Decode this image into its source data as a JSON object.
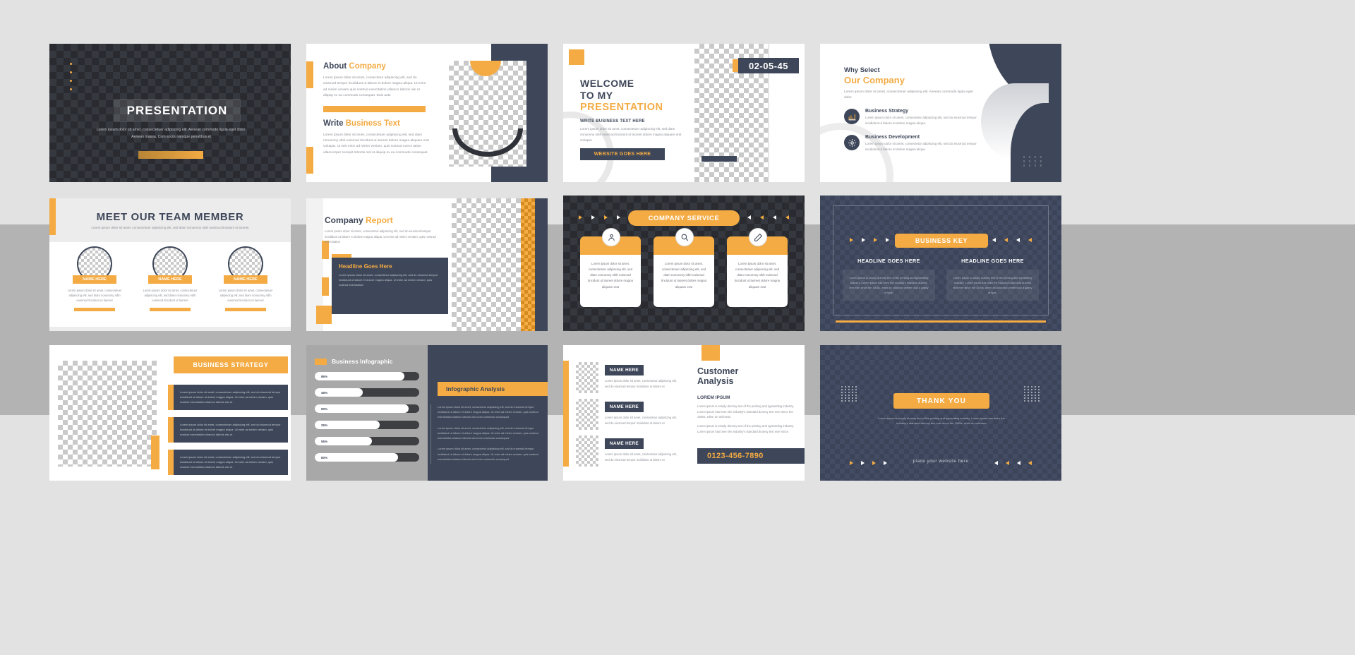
{
  "colors": {
    "navy": "#3e4759",
    "orange": "#f4ab43",
    "dark": "#292b30",
    "bg": "#e2e2e2"
  },
  "lorem": {
    "short": "Lorem ipsum dolor sit amet, consectetuer adipiscing elit, sed diam nonummy nibh euismod tincidunt ut laoreet",
    "hero": "Lorem ipsum dolor sit amet, consectetuer adipiscing elit. Aenean commodo ligula eget dolor. Aenean massa. Cum sociis natoque penatibus et",
    "p1": "Lorem ipsum dolor sit amet, consectetur adipiscing elit, sed do eiusmod tempor incididunt ut labore et dolore magna aliqua. Ut enim ad minim veniam quis nostrud exercitation ullamco laboris nisi ut aliquip ex ea commodo consequat. Duis aute",
    "p2": "Lorem ipsum dolor sit amet, consectetuer adipiscing elit, sed diam nonummy nibh euismod tincidunt ut laoreet dolore magna aliquam erat volutpat. Ut wisi enim ad minim veniam, quis nostrud exerci tation ullamcorper suscipit lobortis nisl ut aliquip ex ea commodo consequat.",
    "p3": "Lorem ipsum dolor sit amet, consectetuer adipiscing elit, sed diam nonummy nibh euismod tincidunt ut laoreet dolore magna aliquam erat volutpat.",
    "p4": "Lorem ipsum dolor sit amet, consectetuer adipiscing elit. Aenean commodo ligula eget dolor.",
    "p5": "Lorem ipsum dolor sit amet, consectetur adipiscing elit, sed do eiusmod tempor incididunt ut labore et dolore magna aliqua.",
    "p6": "Lorem ipsum dolor sit amet, consectetur adipiscing elit, sed do eiusmod tempor incididunt ut labore et dolore magna aliqua. Ut enim ad minim veniam, quis nostrud exercitation",
    "p7": "Lorem ipsum dolor sit amet, consectetuer adipiscing elit, sed do eiusmod tempor incididunt ut labore et dolore magna aliqua. Ut enim ad minim veniam, quis nostrud exercitation",
    "p8": "Lorem ipsum dolor sit amet, consectetuer adipiscing elit, sed do eiusmod tempor incididunt ut labore et dolore magna aliqua. Ut enim ad minim veniam, quis nostrud exercitation ullamco laboris nisi ut ea commodo consequat.",
    "p9": "Lorem ipsum dolor sit amet, consectetur adipiscing elit, sed do eiusmod tempor incididunt ut labore et",
    "p10": "Lorem ipsum dolor sit amet, consectetur adipiscing elit, sed do eiusmod tempor incididunt ut labore et",
    "p11": "Lorem ipsum is simply dummy text of the printing and typesetting industry. Lorem ipsum has been the industry's standard dummy text ever since.",
    "p12": "Lorem ipsum is simply dummy text of the printing and typesetting industry. Lorem ipsum has been the industry's standard dummy text ever since the 1500s, when an unknown printer took a galley of type.",
    "p13": "Lorem ipsum is simply dummy text of the printing and typesetting industry. Lorem ipsum has been the industry's standard dummy text ever since the 1500s, when an unknown",
    "svc": "Lorem ipsum dolor sit amet, consectetuer adipiscing elit, sed diam nonummy nibh euismod tincidunt ut laoreet dolore magna aliquam erat"
  },
  "slide1": {
    "title": "PRESENTATION",
    "subtitle": "Lorem ipsum dolor sit amet, consectetuer adipiscing elit. Aenean commodo ligula eget dolor. Aenean massa. Cum sociis natoque penatibus et"
  },
  "slide2": {
    "heading_dark": "About",
    "heading_accent": "Company",
    "body1": "Lorem ipsum dolor sit amet, consectetur adipiscing elit, sed do eiusmod tempor incididunt ut labore et dolore magna aliqua. Ut enim ad minim veniam quis nostrud exercitation ullamco laboris nisi ut aliquip ex ea commodo consequat. Duis aute",
    "heading2_dark": "Write",
    "heading2_accent": "Business Text",
    "body2": "Lorem ipsum dolor sit amet, consectetuer adipiscing elit, sed diam nonummy nibh euismod tincidunt ut laoreet dolore magna aliquam erat volutpat. Ut wisi enim ad minim veniam, quis nostrud exerci tation ullamcorper suscipit lobortis nisl ut aliquip ex ea commodo consequat."
  },
  "slide3": {
    "line1": "WELCOME",
    "line2": "TO MY",
    "line3": "PRESENTATION",
    "subhead": "WRITE BUSINESS TEXT HERE",
    "body": "Lorem ipsum dolor sit amet, consectetuer adipiscing elit, sed diam nonummy nibh euismod tincidunt ut laoreet dolore magna aliquam erat volutpat.",
    "button": "WEBSITE GOES HERE",
    "date": "02-05-45"
  },
  "slide4": {
    "heading_dark": "Why Select",
    "heading_accent": "Our Company",
    "intro": "Lorem ipsum dolor sit amet, consectetuer adipiscing elit. Aenean commodo ligula eget dolor.",
    "features": [
      {
        "icon": "chart-bar-icon",
        "title": "Business Strategy",
        "text": "Lorem ipsum dolor sit amet, consectetur adipiscing elit, sed do eiusmod tempor incididunt ut labore et dolore magna aliqua."
      },
      {
        "icon": "gear-icon",
        "title": "Business Development",
        "text": "Lorem ipsum dolor sit amet, consectetur adipiscing elit, sed do eiusmod tempor incididunt ut labore et dolore magna aliqua."
      }
    ],
    "decor_text": "x x x x\nx x x x\nx x x x"
  },
  "slide5": {
    "title": "MEET OUR TEAM MEMBER",
    "subtitle": "Lorem ipsum dolor sit amet, consectetuer adipiscing elit, sed diam nonummy nibh euismod tincidunt ut laoreet",
    "members": [
      {
        "name": "NAME HERE",
        "text": "Lorem ipsum dolor sit amet, consectetuer adipiscing elit, sed diam nonummy nibh euismod tincidunt ut laoreet"
      },
      {
        "name": "NAME HERE",
        "text": "Lorem ipsum dolor sit amet, consectetuer adipiscing elit, sed diam nonummy nibh euismod tincidunt ut laoreet"
      },
      {
        "name": "NAME HERE",
        "text": "Lorem ipsum dolor sit amet, consectetuer adipiscing elit, sed diam nonummy nibh euismod tincidunt ut laoreet"
      }
    ]
  },
  "slide6": {
    "heading_dark": "Company",
    "heading_accent": "Report",
    "intro": "Lorem ipsum dolor sit amet, consectetur adipiscing elit, sed do eiusmod tempor incididunt ut labore et dolore magna aliqua. Ut enim ad minim veniam, quis nostrud exercitation",
    "card_title": "Headline Goes Here",
    "card_text": "Lorem ipsum dolor sit amet, consectetur adipiscing elit, sed do eiusmod tempor incididunt ut labore et dolore magna aliqua. Ut enim ad minim veniam, quis nostrud exercitation"
  },
  "slide7": {
    "title": "COMPANY SERVICE",
    "cards": [
      {
        "icon": "user-icon",
        "text": "Lorem ipsum dolor sit amet, consectetuer adipiscing elit, sed diam nonummy nibh euismod tincidunt ut laoreet dolore magna aliquam erat"
      },
      {
        "icon": "magnifier-icon",
        "text": "Lorem ipsum dolor sit amet, consectetuer adipiscing elit, sed diam nonummy nibh euismod tincidunt ut laoreet dolore magna aliquam erat"
      },
      {
        "icon": "pencil-icon",
        "text": "Lorem ipsum dolor sit amet, consectetuer adipiscing elit, sed diam nonummy nibh euismod tincidunt ut laoreet dolore magna aliquam erat"
      }
    ]
  },
  "slide8": {
    "title": "BUSINESS KEY",
    "columns": [
      {
        "heading": "HEADLINE GOES HERE",
        "text": "Lorem ipsum is simply dummy text of the printing and typesetting industry. Lorem ipsum has been the industry's standard dummy text ever since the 1500s, when an unknown printer took a galley of type."
      },
      {
        "heading": "HEADLINE GOES HERE",
        "text": "Lorem ipsum is simply dummy text of the printing and typesetting industry. Lorem ipsum has been the industry's standard dummy text ever since the 1500s, when an unknown printer took a galley of type."
      }
    ]
  },
  "slide9": {
    "banner": "BUSINESS STRATEGY",
    "rows": [
      {
        "text": "Lorem ipsum dolor sit amet, consectetuer adipiscing elit, sed do eiusmod tempor incididunt ut labore et dolore magna aliqua. Ut enim ad minim veniam, quis nostrud exercitation ullamco laboris nisi ut"
      },
      {
        "text": "Lorem ipsum dolor sit amet, consectetuer adipiscing elit, sed do eiusmod tempor incididunt ut labore et dolore magna aliqua. Ut enim ad minim veniam, quis nostrud exercitation ullamco laboris nisi ut"
      },
      {
        "text": "Lorem ipsum dolor sit amet, consectetuer adipiscing elit, sed do eiusmod tempor incididunt ut labore et dolore magna aliqua. Ut enim ad minim veniam, quis nostrud exercitation ullamco laboris nisi ut"
      }
    ]
  },
  "slide10": {
    "title": "Business Infographic",
    "ribbon": "Infographic Analysis",
    "paragraphs": [
      "Lorem ipsum dolor sit amet, consectetur adipiscing elit, sed do eiusmod tempor incididunt ut labore et dolore magna aliqua. Ut enim ad minim veniam, quis nostrud exercitation ullamco laboris nisi ut ea commodo consequat.",
      "Lorem ipsum dolor sit amet, consectetur adipiscing elit, sed do eiusmod tempor incididunt ut labore et dolore magna aliqua. Ut enim ad minim veniam, quis nostrud exercitation ullamco laboris nisi ut ea commodo consequat.",
      "Lorem ipsum dolor sit amet, consectetur adipiscing elit, sed do eiusmod tempor incididunt ut labore et dolore magna aliqua. Ut enim ad minim veniam, quis nostrud exercitation ullamco laboris nisi ut ea commodo consequat."
    ]
  },
  "slide11": {
    "items": [
      {
        "name": "NAME HERE",
        "text": "Lorem ipsum dolor sit amet, consectetur adipiscing elit, sed do eiusmod tempor incididunt ut labore et"
      },
      {
        "name": "NAME HERE",
        "text": "Lorem ipsum dolor sit amet, consectetur adipiscing elit, sed do eiusmod tempor incididunt ut labore et"
      },
      {
        "name": "NAME HERE",
        "text": "Lorem ipsum dolor sit amet, consectetur adipiscing elit, sed do eiusmod tempor incididunt ut labore et"
      }
    ],
    "title_line1": "Customer",
    "title_line2": "Analysis",
    "subhead": "LOREM IPSUM",
    "body1": "Lorem ipsum is simply dummy text of the printing and typesetting industry. Lorem ipsum has been the industry's standard dummy text ever since the 1500s, when an unknown",
    "body2": "Lorem ipsum is simply dummy text of the printing and typesetting industry. Lorem ipsum has been the industry's standard dummy text ever since.",
    "phone": "0123-456-7890"
  },
  "slide12": {
    "title": "THANK YOU",
    "subtitle": "Lorem ipsum is simply dummy text of the printing and typesetting industry. Lorem ipsum has been the industry's standard dummy text ever since the 1500s, when an unknown",
    "website": "place your website here"
  },
  "chart_data": {
    "type": "bar",
    "title": "Business Infographic",
    "orientation": "horizontal",
    "categories": [
      "86%",
      "46%",
      "90%",
      "25%",
      "55%",
      "80%"
    ],
    "values": [
      86,
      46,
      90,
      25,
      55,
      80
    ],
    "labels": [
      "86%",
      "46%",
      "90%",
      "25%",
      "55%",
      "80%"
    ],
    "xlabel": "",
    "ylabel": "",
    "xlim": [
      0,
      100
    ],
    "grid": false,
    "legend": "none"
  }
}
